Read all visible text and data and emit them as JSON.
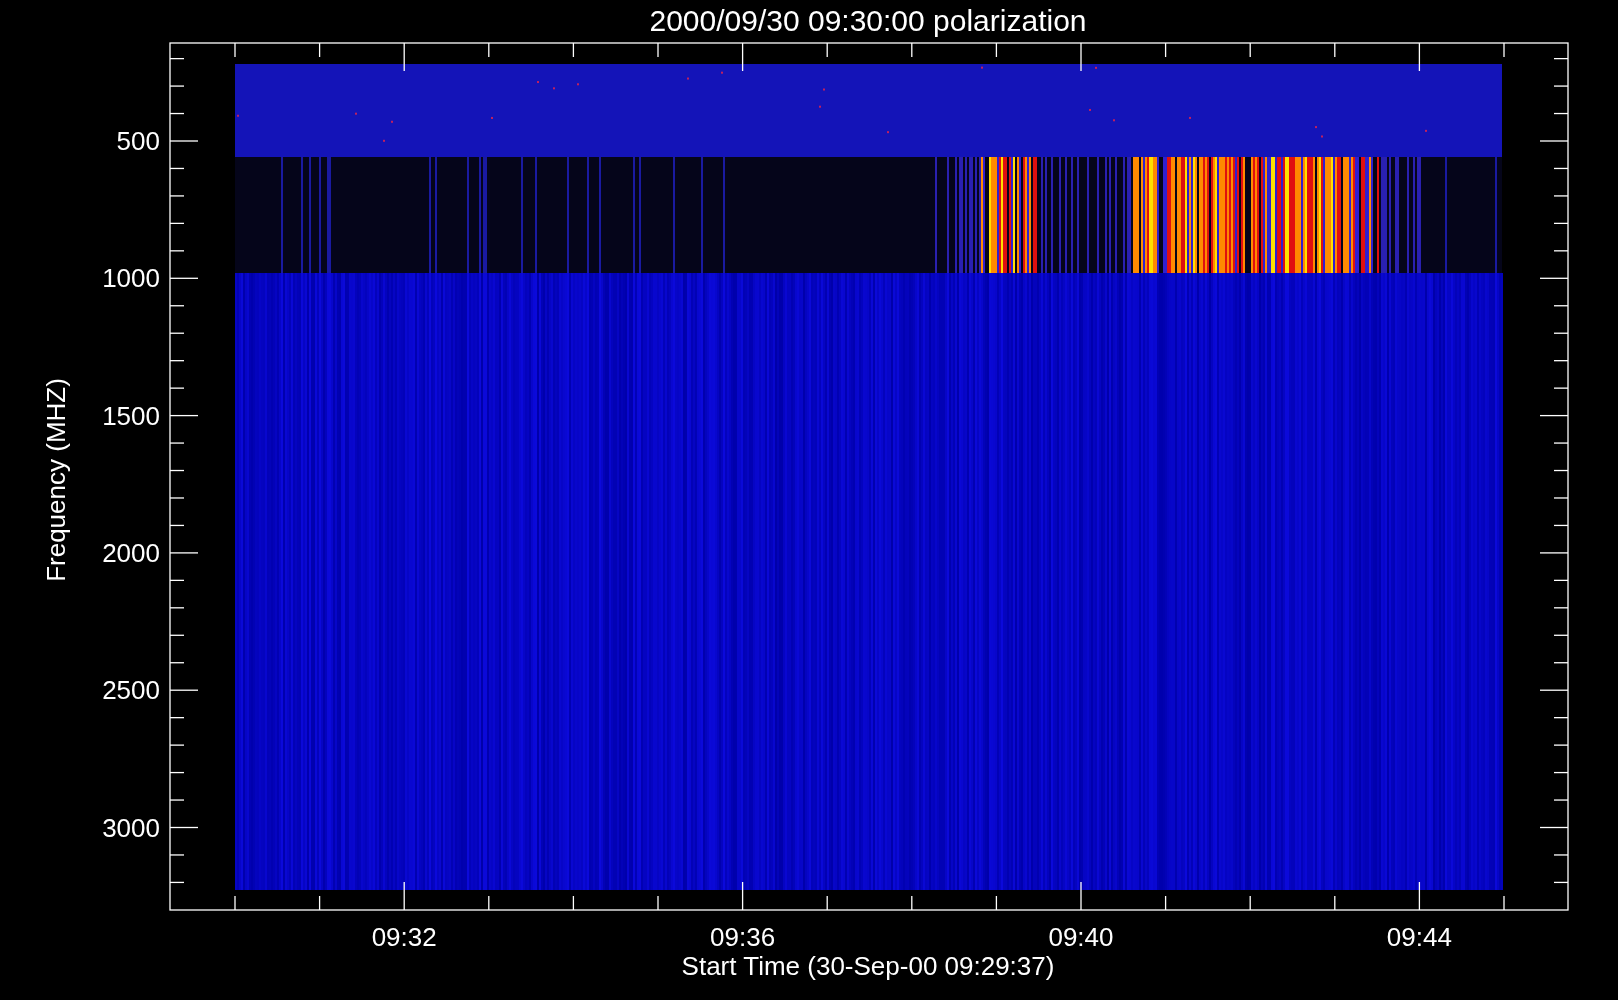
{
  "title": "2000/09/30 09:30:00 polarization",
  "y_axis": {
    "label": "Frequency (MHZ)",
    "ticks": [
      "500",
      "1000",
      "1500",
      "2000",
      "2500",
      "3000"
    ]
  },
  "x_axis": {
    "label": "Start Time (30-Sep-00 09:29:37)",
    "ticks": [
      "09:32",
      "09:36",
      "09:40",
      "09:44"
    ]
  }
}
